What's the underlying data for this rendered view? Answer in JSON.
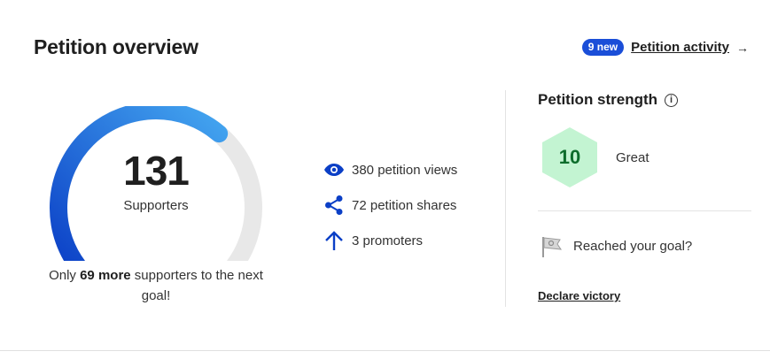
{
  "header": {
    "title": "Petition overview",
    "activity_badge": "9 new",
    "activity_link": "Petition activity",
    "activity_arrow": "→"
  },
  "gauge": {
    "value": "131",
    "label": "Supporters",
    "progress_fraction": 0.655,
    "goal_text_before": "Only ",
    "goal_text_bold": "69 more",
    "goal_text_after": " supporters to the next goal!",
    "colors": {
      "start": "#0b3fc6",
      "end": "#44a6f0",
      "track": "#e8e8e8"
    }
  },
  "stats": [
    {
      "icon": "eye-icon",
      "label": "380 petition views"
    },
    {
      "icon": "share-icon",
      "label": "72 petition shares"
    },
    {
      "icon": "arrow-up-icon",
      "label": "3 promoters"
    }
  ],
  "strength": {
    "title": "Petition strength",
    "info_icon": "info-icon",
    "score": "10",
    "rating": "Great",
    "hex_color": "#c3f4d2",
    "score_color": "#0d6d2c"
  },
  "victory": {
    "prompt": "Reached your goal?",
    "link": "Declare victory",
    "icon": "flag-icon"
  }
}
